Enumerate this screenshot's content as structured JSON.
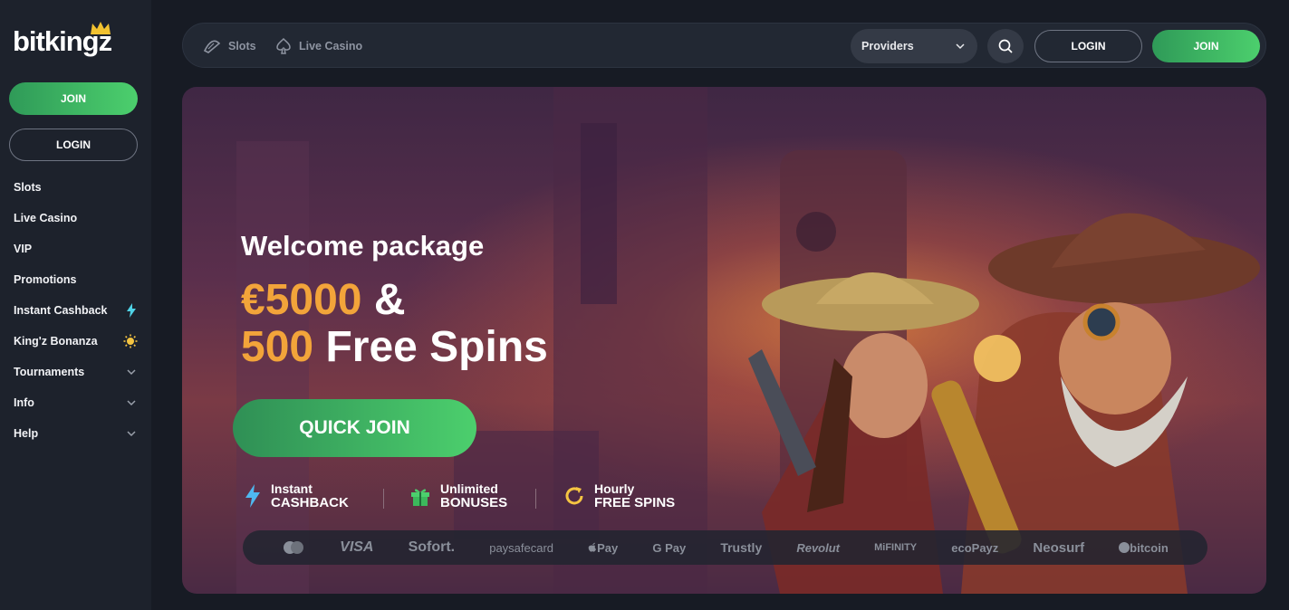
{
  "brand": {
    "name": "bitkingz"
  },
  "sidebar": {
    "join_label": "JOIN",
    "login_label": "LOGIN",
    "items": [
      {
        "label": "Slots",
        "icon": "",
        "chevron": false
      },
      {
        "label": "Live Casino",
        "icon": "",
        "chevron": false
      },
      {
        "label": "VIP",
        "icon": "",
        "chevron": false
      },
      {
        "label": "Promotions",
        "icon": "",
        "chevron": false
      },
      {
        "label": "Instant Cashback",
        "icon": "lightning-icon",
        "chevron": false
      },
      {
        "label": "King'z Bonanza",
        "icon": "sun-icon",
        "chevron": false
      },
      {
        "label": "Tournaments",
        "icon": "",
        "chevron": true
      },
      {
        "label": "Info",
        "icon": "",
        "chevron": true
      },
      {
        "label": "Help",
        "icon": "",
        "chevron": true
      }
    ]
  },
  "topbar": {
    "slots_label": "Slots",
    "live_casino_label": "Live Casino",
    "providers_label": "Providers",
    "login_label": "LOGIN",
    "join_label": "JOIN"
  },
  "hero": {
    "title": "Welcome package",
    "amount": "€5000",
    "amp": "&",
    "spins_count": "500",
    "spins_label": "Free Spins",
    "cta_label": "QUICK JOIN",
    "features": [
      {
        "line1": "Instant",
        "line2": "CASHBACK",
        "icon": "lightning-icon"
      },
      {
        "line1": "Unlimited",
        "line2": "BONUSES",
        "icon": "gift-icon"
      },
      {
        "line1": "Hourly",
        "line2": "FREE SPINS",
        "icon": "refresh-icon"
      }
    ]
  },
  "payments": [
    "VISA",
    "Sofort.",
    "paysafecard",
    "Pay",
    "G Pay",
    "Trustly",
    "Revolut",
    "MiFINITY",
    "ecoPayz",
    "Neosurf",
    "bitcoin"
  ],
  "colors": {
    "accent_green": "#4ccf6d",
    "gold": "#f2a43a",
    "sidebar_bg": "#1d222c"
  }
}
